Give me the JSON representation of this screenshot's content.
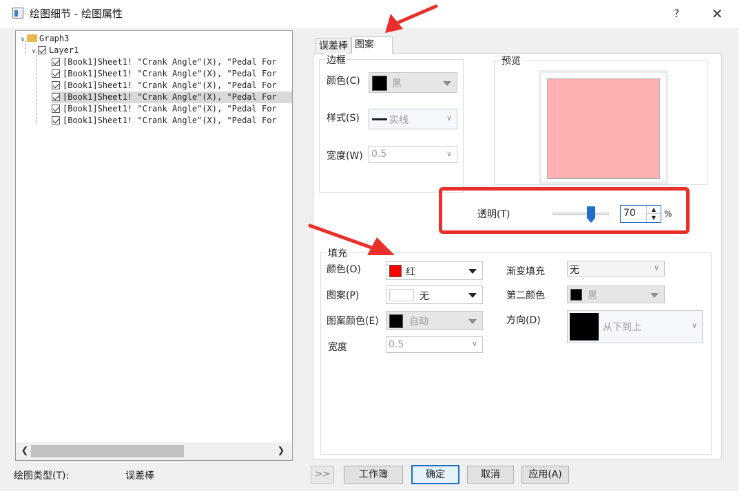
{
  "window": {
    "title": "绘图细节 - 绘图属性",
    "help": "?",
    "close": "✕"
  },
  "tree": {
    "root": "Graph3",
    "layer": "Layer1",
    "items": [
      "[Book1]Sheet1! \"Crank Angle\"(X), \"Pedal For",
      "[Book1]Sheet1! \"Crank Angle\"(X), \"Pedal For",
      "[Book1]Sheet1! \"Crank Angle\"(X), \"Pedal For",
      "[Book1]Sheet1! \"Crank Angle\"(X), \"Pedal For",
      "[Book1]Sheet1! \"Crank Angle\"(X), \"Pedal For",
      "[Book1]Sheet1! \"Crank Angle\"(X), \"Pedal For"
    ]
  },
  "plot_type": {
    "label": "绘图类型(T):",
    "value": "误差棒"
  },
  "tabs": [
    "误差棒",
    "图案"
  ],
  "border_group": {
    "title": "边框",
    "color_label": "颜色(C)",
    "color_value": "黑",
    "style_label": "样式(S)",
    "style_value": "实线",
    "width_label": "宽度(W)",
    "width_value": "0.5"
  },
  "preview": {
    "title": "预览",
    "fill_color": "#ffb0b0"
  },
  "transparency": {
    "label": "透明(T)",
    "value": "70",
    "unit": "%",
    "slider_level": 0.7
  },
  "fill_group": {
    "title": "填充",
    "color_label": "颜色(O)",
    "color_value": "红",
    "pattern_label": "图案(P)",
    "pattern_value": "无",
    "pattern_color_label": "图案颜色(E)",
    "pattern_color_value": "自动",
    "width_label": "宽度",
    "width_value": "0.5",
    "gradient_label": "渐变填充",
    "gradient_value": "无",
    "second_color_label": "第二颜色",
    "second_color_value": "黑",
    "direction_label": "方向(D)",
    "direction_value": "从下到上"
  },
  "buttons": {
    "expand": ">>",
    "workbook": "工作簿",
    "ok": "确定",
    "cancel": "取消",
    "apply": "应用(A)"
  },
  "colors": {
    "highlight": "#e8302a",
    "arrow": "#e8302a",
    "red": "#ff0000",
    "black": "#000000",
    "slider_thumb": "#1f6fc8"
  }
}
